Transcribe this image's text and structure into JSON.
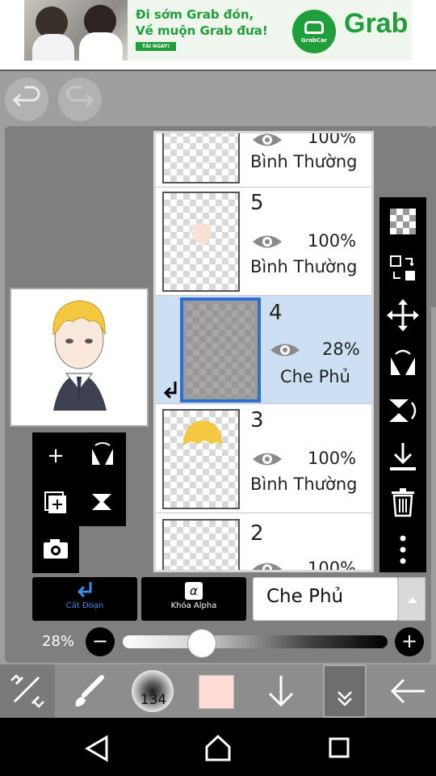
{
  "ad": {
    "headline_line1": "Đi sớm Grab đón,",
    "headline_line2": "Về muộn Grab đưa!",
    "cta": "TẢI NGAY!",
    "logo_label": "GrabCar",
    "brand": "Grab"
  },
  "history": {
    "undo_icon": "undo-icon",
    "redo_icon": "redo-icon"
  },
  "left_tools": [
    "add-layer-icon",
    "flip-layer-icon",
    "duplicate-layer-icon",
    "merge-down-icon",
    "camera-icon"
  ],
  "layers": [
    {
      "number": "",
      "opacity": "100%",
      "blend": "Bình Thường",
      "selected": false
    },
    {
      "number": "5",
      "opacity": "100%",
      "blend": "Bình Thường",
      "selected": false
    },
    {
      "number": "4",
      "opacity": "28%",
      "blend": "Che Phủ",
      "selected": true,
      "clipped": true
    },
    {
      "number": "3",
      "opacity": "100%",
      "blend": "Bình Thường",
      "selected": false
    },
    {
      "number": "2",
      "opacity": "100%",
      "blend": "",
      "selected": false
    }
  ],
  "right_tools": [
    "checkerboard-icon",
    "layer-transfer-icon",
    "move-icon",
    "flip-horizontal-icon",
    "flip-vertical-icon",
    "download-icon",
    "trash-icon",
    "more-icon"
  ],
  "bottom": {
    "clip_label": "Cắt Đoạn",
    "alpha_label": "Khóa Alpha",
    "alpha_symbol": "α",
    "blend_mode": "Che Phủ",
    "opacity_label": "28%",
    "opacity_value": 0.28
  },
  "toolbar": {
    "brush_size": "134",
    "color": "#fcdcd4"
  },
  "colors": {
    "accent": "#2f6fcf",
    "selected_layer_bg": "#cde0f3",
    "grab_green": "#1f9e3a"
  }
}
